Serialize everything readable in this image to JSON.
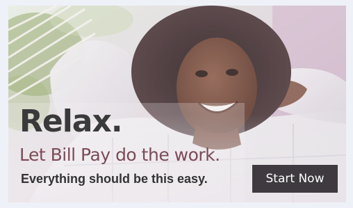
{
  "banner": {
    "headline": "Relax.",
    "subhead": "Let Bill Pay do the work.",
    "tagline": "Everything should be this easy.",
    "cta_label": "Start Now",
    "colors": {
      "headline": "#3a3a3a",
      "subhead": "#7b4b57",
      "cta_background": "#3e3a3f",
      "cta_text": "#ffffff"
    }
  }
}
